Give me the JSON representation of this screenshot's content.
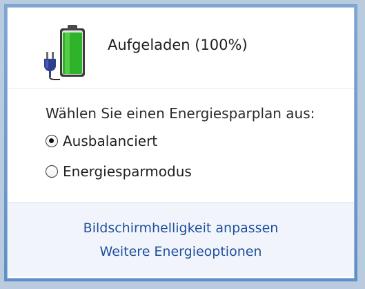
{
  "status": {
    "icon": "battery-plugged-icon",
    "text": "Aufgeladen (100%)",
    "charge_fraction": 1.0
  },
  "power_plans": {
    "prompt": "Wählen Sie einen Energiesparplan aus:",
    "options": [
      {
        "label": "Ausbalanciert",
        "selected": true
      },
      {
        "label": "Energiesparmodus",
        "selected": false
      }
    ]
  },
  "links": {
    "brightness": "Bildschirmhelligkeit anpassen",
    "more_options": "Weitere Energieoptionen"
  },
  "colors": {
    "accent_link": "#1e4f9b",
    "battery_fill": "#2fb32a",
    "frame": "#6f9acd",
    "footer_bg": "#f1f5fb"
  }
}
